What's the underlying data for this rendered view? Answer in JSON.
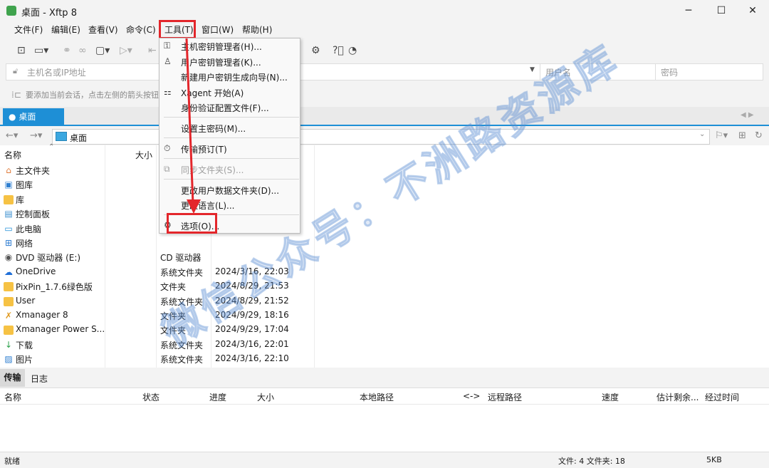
{
  "window": {
    "title": "桌面 - Xftp 8",
    "controls": {
      "minimize": "─",
      "maximize": "☐",
      "close": "✕"
    }
  },
  "menu": [
    "文件(F)",
    "编辑(E)",
    "查看(V)",
    "命令(C)",
    "工具(T)",
    "窗口(W)",
    "帮助(H)"
  ],
  "address": {
    "host_placeholder": "主机名或IP地址",
    "username_placeholder": "用户名",
    "password_placeholder": "密码"
  },
  "hint": "要添加当前会话，点击左侧的箭头按钮",
  "tab": {
    "label": "桌面"
  },
  "nav": {
    "path": "桌面"
  },
  "file_list": {
    "columns": [
      "名称",
      "大小"
    ],
    "rows": [
      {
        "name": "主文件夹",
        "type": "",
        "date": "",
        "icon": "home-icon"
      },
      {
        "name": "图库",
        "type": "",
        "date": "",
        "icon": "gallery-icon"
      },
      {
        "name": "库",
        "type": "",
        "date": "",
        "icon": "folder-icon"
      },
      {
        "name": "控制面板",
        "type": "",
        "date": "",
        "icon": "control-panel-icon"
      },
      {
        "name": "此电脑",
        "type": "",
        "date": "",
        "icon": "computer-icon"
      },
      {
        "name": "网络",
        "type": "",
        "date": "",
        "icon": "network-icon"
      },
      {
        "name": "DVD 驱动器 (E:)",
        "type": "CD 驱动器",
        "date": "",
        "icon": "dvd-icon"
      },
      {
        "name": "OneDrive",
        "type": "系统文件夹",
        "date": "2024/3/16, 22:03",
        "icon": "cloud-icon"
      },
      {
        "name": "PixPin_1.7.6绿色版",
        "type": "文件夹",
        "date": "2024/8/29, 21:53",
        "icon": "folder-icon"
      },
      {
        "name": "User",
        "type": "系统文件夹",
        "date": "2024/8/29, 21:52",
        "icon": "folder-icon"
      },
      {
        "name": "Xmanager 8",
        "type": "文件夹",
        "date": "2024/9/29, 18:16",
        "icon": "xmanager-icon"
      },
      {
        "name": "Xmanager Power S...",
        "type": "文件夹",
        "date": "2024/9/29, 17:04",
        "icon": "folder-icon"
      },
      {
        "name": "下载",
        "type": "系统文件夹",
        "date": "2024/3/16, 22:01",
        "icon": "download-icon"
      },
      {
        "name": "图片",
        "type": "系统文件夹",
        "date": "2024/3/16, 22:10",
        "icon": "picture-icon"
      }
    ]
  },
  "tools_menu": {
    "items": [
      {
        "label": "主机密钥管理者(H)...",
        "icon": "host-key-icon",
        "enabled": true
      },
      {
        "label": "用户密钥管理者(K)...",
        "icon": "user-key-icon",
        "enabled": true
      },
      {
        "label": "新建用户密钥生成向导(N)...",
        "icon": "",
        "enabled": true
      },
      {
        "label": "Xagent 开始(A)",
        "icon": "xagent-icon",
        "enabled": true
      },
      {
        "label": "身份验证配置文件(F)...",
        "icon": "",
        "enabled": true
      },
      {
        "label": "设置主密码(M)...",
        "icon": "",
        "enabled": true
      },
      {
        "label": "传输预订(T)",
        "icon": "clock-icon",
        "enabled": true
      },
      {
        "label": "同步文件夹(S)...",
        "icon": "sync-icon",
        "enabled": false
      },
      {
        "label": "更改用户数据文件夹(D)...",
        "icon": "",
        "enabled": true
      },
      {
        "label": "更改语言(L)...",
        "icon": "",
        "enabled": true
      },
      {
        "label": "选项(O)...",
        "icon": "gear-icon",
        "enabled": true
      }
    ]
  },
  "transfer": {
    "tabs": [
      "传输",
      "日志"
    ],
    "columns": [
      "名称",
      "状态",
      "进度",
      "大小",
      "本地路径",
      "<->",
      "远程路径",
      "速度",
      "估计剩余...",
      "经过时间"
    ]
  },
  "status": {
    "left": "就绪",
    "counts": "文件: 4  文件夹: 18",
    "size": "5KB"
  },
  "watermark": "微信公众号：不洲路资源库",
  "colors": {
    "accent": "#1e8fd6",
    "highlight": "#e3262b",
    "folder": "#f6c244"
  }
}
